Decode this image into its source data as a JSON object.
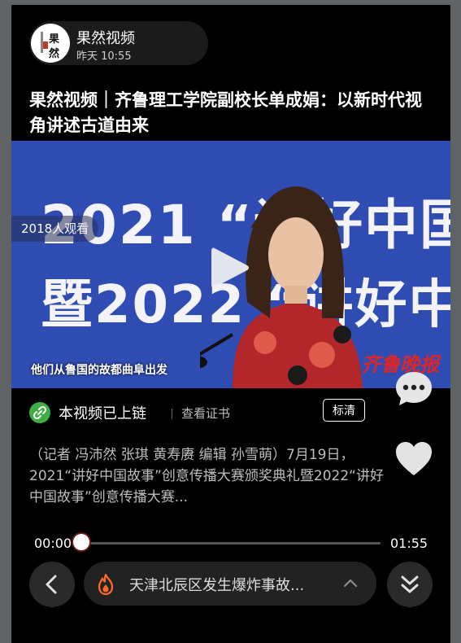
{
  "header": {
    "avatar_text_1": "果",
    "avatar_text_2": "然",
    "channel_name": "果然视频",
    "time": "昨天 10:55"
  },
  "title": "果然视频｜齐鲁理工学院副校长单成娟：以新时代视角讲述古道由来",
  "video": {
    "banner_line_1": "2021 “讲好中国",
    "banner_line_2": "暨2022 “讲好中",
    "viewers": "2018人观看",
    "subtitle": "他们从鲁国的故都曲阜出发",
    "watermark": "齐鲁晚报"
  },
  "chain": {
    "label": "本视频已上链",
    "cert_link": "查看证书",
    "quality": "标清"
  },
  "description": "（记者 冯沛然 张琪 黄寿赓 编辑 孙雪萌）7月19日，2021“讲好中国故事”创意传播大赛颁奖典礼暨2022“讲好中国故事”创意传播大赛...",
  "player": {
    "current_time": "00:00",
    "total_time": "01:55",
    "progress": 0
  },
  "bottom": {
    "trend_text": "天津北辰区发生爆炸事故..."
  },
  "icons": {
    "chain": "link-icon",
    "comment": "comment-icon",
    "like": "heart-icon",
    "prev": "chevron-left-icon",
    "fire": "fire-icon",
    "expand": "chevron-up-icon",
    "next": "double-chevron-down-icon"
  },
  "colors": {
    "background": "#000000",
    "chain_green": "#3fae47",
    "video_blue": "#2f4cb3",
    "fire_orange": "#ff6a2a"
  }
}
